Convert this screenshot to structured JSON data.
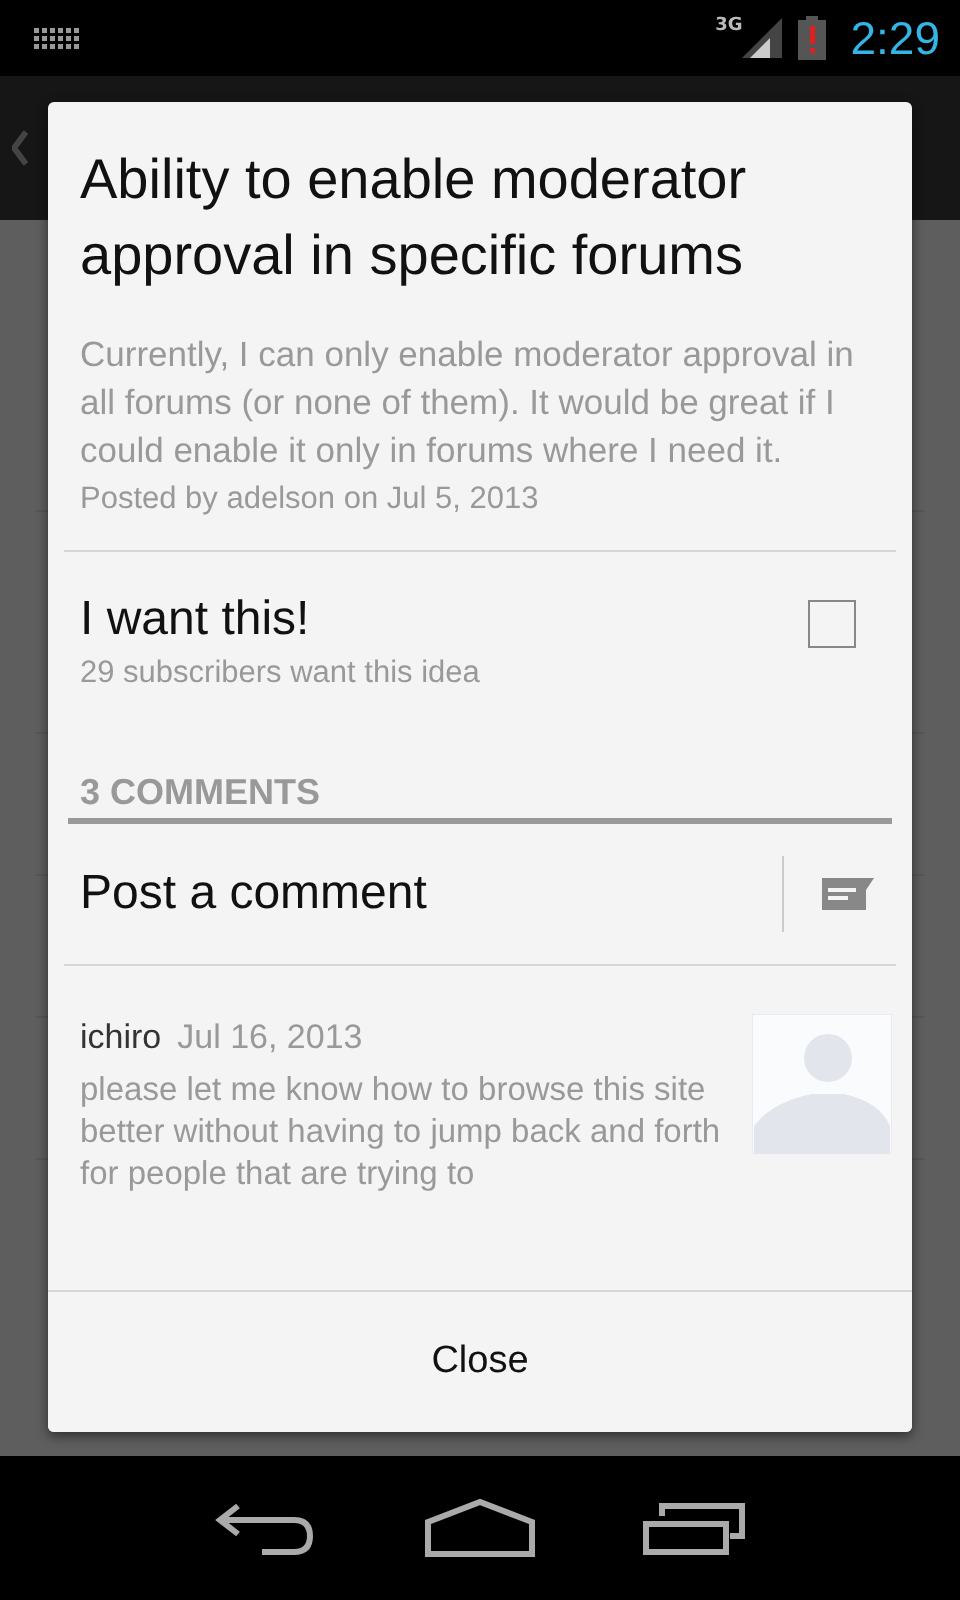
{
  "status_bar": {
    "network": "3G",
    "time": "2:29"
  },
  "dialog": {
    "title": "Ability to enable moderator approval in specific forums",
    "description": "Currently, I can only enable moderator approval in all forums (or none of them). It would be great if I could enable it only in forums where I need it.",
    "posted": "Posted by adelson on Jul 5, 2013",
    "want": {
      "label": "I want this!",
      "subscribers": "29 subscribers want this idea",
      "checked": false
    },
    "comments_header": "3 COMMENTS",
    "post_comment": "Post a comment",
    "comments": [
      {
        "author": "ichiro",
        "date": "Jul 16, 2013",
        "text": "please let me know how to browse this site better without having to jump back and forth for people that are trying to"
      }
    ],
    "close": "Close"
  }
}
